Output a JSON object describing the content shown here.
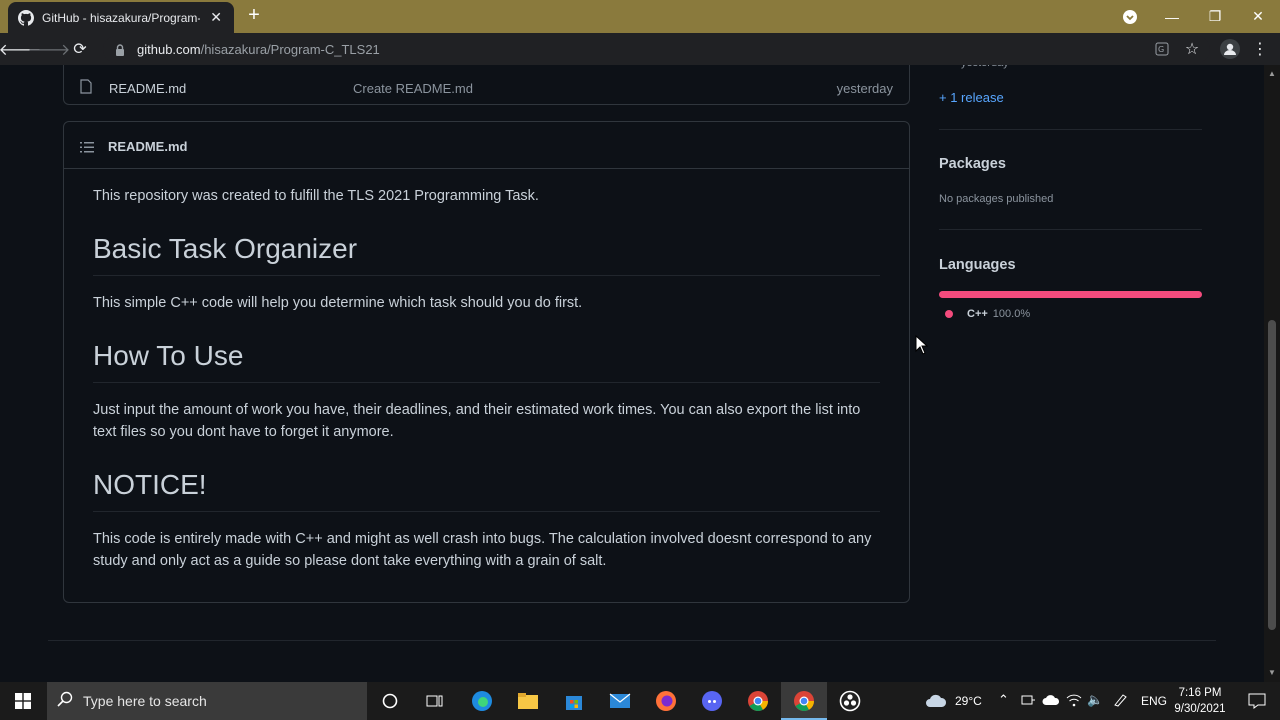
{
  "browser": {
    "tab_title": "GitHub - hisazakura/Program-C_",
    "url_host": "github.com",
    "url_path": "/hisazakura/Program-C_TLS21"
  },
  "file_row": {
    "name": "README.md",
    "message": "Create README.md",
    "time": "yesterday"
  },
  "readme": {
    "title": "README.md",
    "intro": "This repository was created to fulfill the TLS 2021 Programming Task.",
    "h1": "Basic Task Organizer",
    "p1": "This simple C++ code will help you determine which task should you do first.",
    "h2": "How To Use",
    "p2": "Just input the amount of work you have, their deadlines, and their estimated work times. You can also export the list into text files so you dont have to forget it anymore.",
    "h3": "NOTICE!",
    "p3": "This code is entirely made with C++ and might as well crash into bugs. The calculation involved doesnt correspond to any study and only act as a guide so please dont take everything with a grain of salt."
  },
  "sidebar": {
    "release_time": "yesterday",
    "release_link": "+ 1 release",
    "packages_title": "Packages",
    "packages_note": "No packages published",
    "languages_title": "Languages",
    "language_name": "C++",
    "language_pct": "100.0%",
    "language_color": "#f34b7d"
  },
  "taskbar": {
    "search_placeholder": "Type here to search",
    "temperature": "29°C",
    "lang": "ENG",
    "time": "7:16 PM",
    "date": "9/30/2021"
  }
}
